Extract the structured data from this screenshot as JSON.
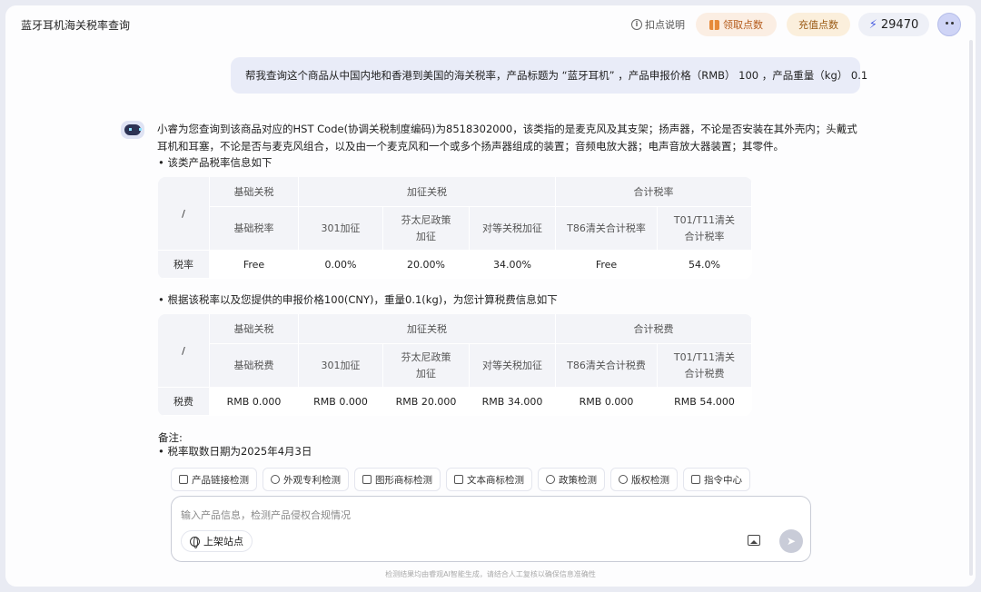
{
  "header": {
    "title": "蓝牙耳机海关税率查询",
    "help_label": "扣点说明",
    "get_points_label": "领取点数",
    "recharge_label": "充值点数",
    "balance": "29470"
  },
  "user_message": "帮我查询这个商品从中国内地和香港到美国的海关税率，产品标题为 “蓝牙耳机” ，产品申报价格（RMB） 100 ，产品重量（kg） 0.1",
  "bot": {
    "intro": "小睿为您查询到该商品对应的HST Code(协调关税制度编码)为8518302000，该类指的是麦克风及其支架；扬声器，不论是否安装在其外壳内；头戴式耳机和耳塞，不论是否与麦克风组合，以及由一个麦克风和一个或多个扬声器组成的装置；音频电放大器；电声音放大器装置；其零件。",
    "bullet1": "•  该类产品税率信息如下",
    "table1": {
      "corner": "/",
      "groups": [
        "基础关税",
        "加征关税",
        "合计税率"
      ],
      "subs": [
        "基础税率",
        "301加征",
        "芬太尼政策\n加征",
        "对等关税加征",
        "T86清关合计税率",
        "T01/T11清关\n合计税率"
      ],
      "row_label": "税率",
      "values": [
        "Free",
        "0.00%",
        "20.00%",
        "34.00%",
        "Free",
        "54.0%"
      ]
    },
    "bullet2": "•  根据该税率以及您提供的申报价格100(CNY)，重量0.1(kg)，为您计算税费信息如下",
    "table2": {
      "corner": "/",
      "groups": [
        "基础关税",
        "加征关税",
        "合计税费"
      ],
      "subs": [
        "基础税费",
        "301加征",
        "芬太尼政策\n加征",
        "对等关税加征",
        "T86清关合计税费",
        "T01/T11清关\n合计税费"
      ],
      "row_label": "税费",
      "values": [
        "RMB 0.000",
        "RMB 0.000",
        "RMB 20.000",
        "RMB 34.000",
        "RMB 0.000",
        "RMB 54.000"
      ]
    },
    "note_title": "备注:",
    "note_item": "•  税率取数日期为2025年4月3日"
  },
  "tools": [
    "产品链接检测",
    "外观专利检测",
    "图形商标检测",
    "文本商标检测",
    "政策检测",
    "版权检测",
    "指令中心"
  ],
  "input": {
    "placeholder": "输入产品信息，检测产品侵权合规情况",
    "site_label": "上架站点"
  },
  "disclaimer": "检测结果均由睿观AI智能生成，请结合人工复核以确保信息准确性"
}
